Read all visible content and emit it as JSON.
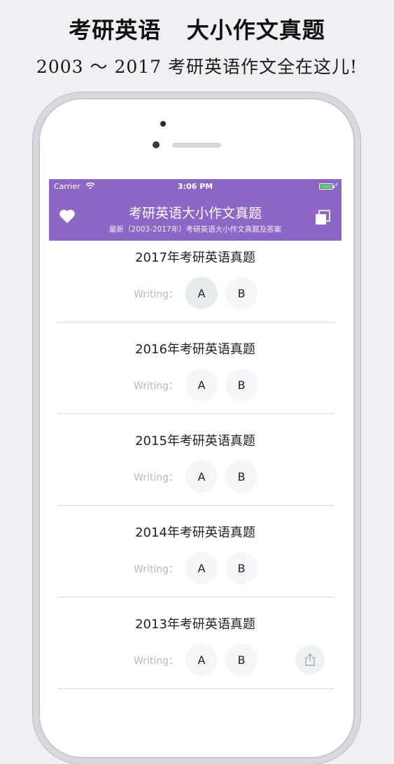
{
  "promo": {
    "title": "考研英语   大小作文真题",
    "subtitle": "2003 ～ 2017 考研英语作文全在这儿!"
  },
  "statusbar": {
    "carrier": "Carrier",
    "time": "3:06 PM",
    "wifi_icon": "wifi-icon",
    "battery_icon": "battery-icon"
  },
  "navbar": {
    "title": "考研英语大小作文真题",
    "subtitle": "最新（2003-2017年）考研英语大小作文真题及答案",
    "left_icon": "heart-icon",
    "right_icon": "copy-icon"
  },
  "colors": {
    "accent": "#8d67c6",
    "battery": "#4cd964"
  },
  "list": {
    "items": [
      {
        "title": "2017年考研英语真题",
        "writing_label": "Writing：",
        "option_a": "A",
        "option_b": "B"
      },
      {
        "title": "2016年考研英语真题",
        "writing_label": "Writing：",
        "option_a": "A",
        "option_b": "B"
      },
      {
        "title": "2015年考研英语真题",
        "writing_label": "Writing：",
        "option_a": "A",
        "option_b": "B"
      },
      {
        "title": "2014年考研英语真题",
        "writing_label": "Writing：",
        "option_a": "A",
        "option_b": "B"
      },
      {
        "title": "2013年考研英语真题",
        "writing_label": "Writing：",
        "option_a": "A",
        "option_b": "B"
      }
    ]
  },
  "share_icon": "share-icon"
}
